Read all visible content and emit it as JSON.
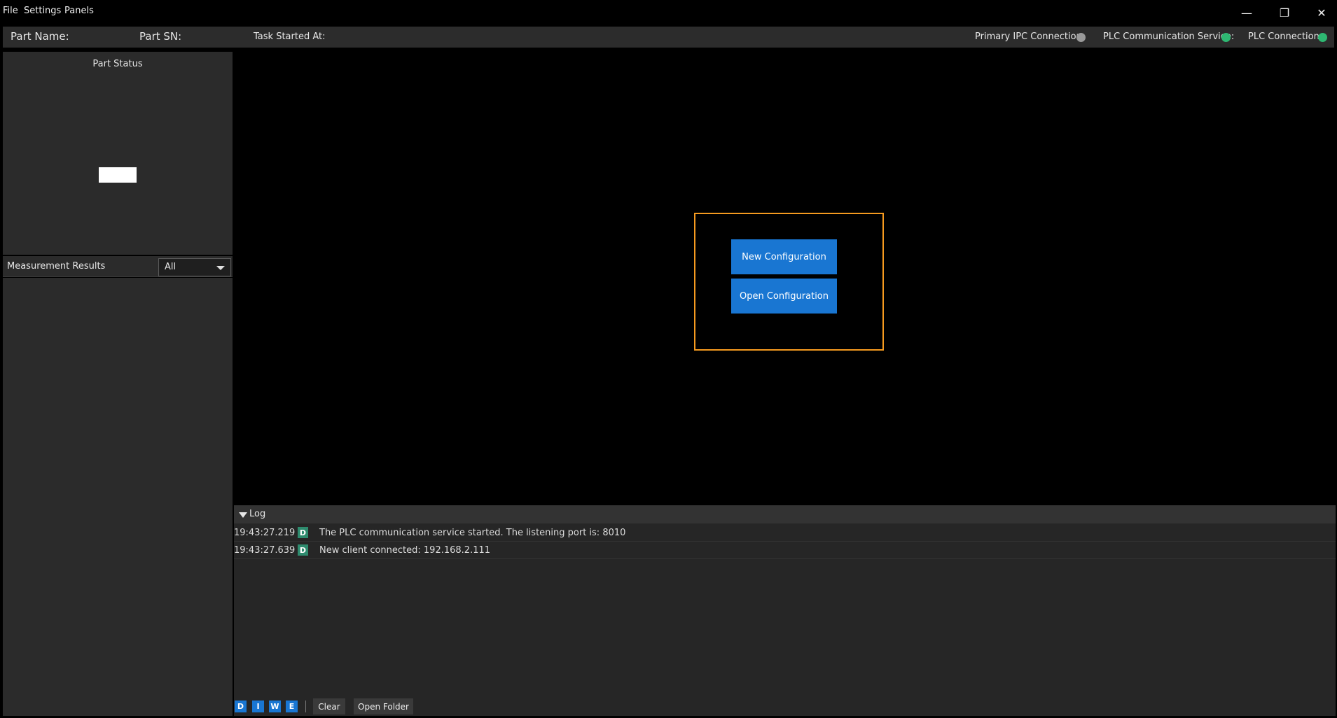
{
  "menu": {
    "items": [
      "File",
      "Settings",
      "Panels"
    ]
  },
  "window_controls": {
    "minimize": "—",
    "restore": "❐",
    "close": "✕"
  },
  "status": {
    "part_name_label": "Part Name:",
    "part_sn_label": "Part SN:",
    "task_started_label": "Task Started At:",
    "primary_ipc_label": "Primary IPC Connection:",
    "primary_ipc_color": "#9a9a9a",
    "plc_comm_label": "PLC Communication Service:",
    "plc_comm_color": "#2eb872",
    "plc_conn_label": "PLC Connection:",
    "plc_conn_color": "#2eb872"
  },
  "part_status": {
    "title": "Part Status"
  },
  "measurement": {
    "title": "Measurement Results",
    "filter_value": "All"
  },
  "config": {
    "new_label": "New Configuration",
    "open_label": "Open Configuration",
    "border_color": "#f59a1f",
    "button_color": "#1976d2"
  },
  "log": {
    "title": "Log",
    "entries": [
      {
        "time": "19:43:27.219",
        "level": "D",
        "message": "The PLC communication service started. The listening port is: 8010"
      },
      {
        "time": "19:43:27.639",
        "level": "D",
        "message": "New client connected: 192.168.2.111"
      }
    ],
    "level_filters": [
      "D",
      "I",
      "W",
      "E"
    ],
    "clear_label": "Clear",
    "open_folder_label": "Open Folder"
  }
}
